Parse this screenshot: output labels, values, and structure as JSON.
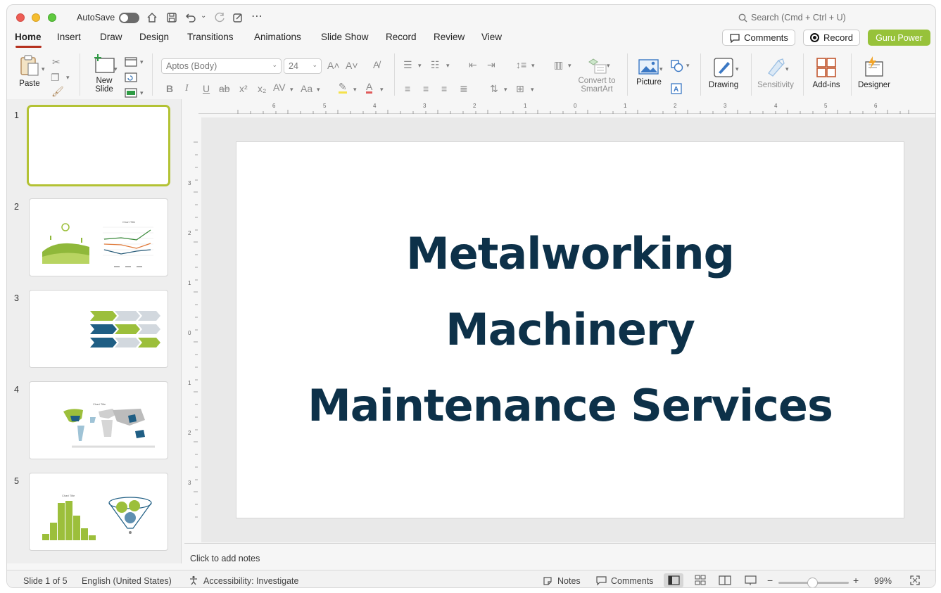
{
  "titlebar": {
    "autosave_label": "AutoSave",
    "search_placeholder": "Search (Cmd + Ctrl + U)"
  },
  "tabs": [
    "Home",
    "Insert",
    "Draw",
    "Design",
    "Transitions",
    "Animations",
    "Slide Show",
    "Record",
    "Review",
    "View"
  ],
  "header_buttons": {
    "comments": "Comments",
    "record": "Record",
    "guru": "Guru Power"
  },
  "ribbon": {
    "paste": "Paste",
    "new_slide_line1": "New",
    "new_slide_line2": "Slide",
    "font_name": "Aptos (Body)",
    "font_size": "24",
    "convert_line1": "Convert to",
    "convert_line2": "SmartArt",
    "picture": "Picture",
    "drawing": "Drawing",
    "sensitivity": "Sensitivity",
    "addins": "Add-ins",
    "designer": "Designer"
  },
  "thumbnails": [
    {
      "number": "1"
    },
    {
      "number": "2",
      "chart_title": "Chart Title"
    },
    {
      "number": "3"
    },
    {
      "number": "4",
      "chart_title": "Chart Title"
    },
    {
      "number": "5",
      "chart_title": "Chart Title"
    }
  ],
  "ruler": {
    "horizontal": [
      "6",
      "5",
      "4",
      "3",
      "2",
      "1",
      "0",
      "1",
      "2",
      "3",
      "4",
      "5",
      "6"
    ],
    "vertical": [
      "3",
      "2",
      "1",
      "0",
      "1",
      "2",
      "3"
    ]
  },
  "slide": {
    "title_lines": [
      "Metalworking",
      "Machinery",
      "Maintenance Services"
    ]
  },
  "notes_placeholder": "Click to add notes",
  "statusbar": {
    "slide_info": "Slide 1 of 5",
    "language": "English (United States)",
    "accessibility": "Accessibility: Investigate",
    "notes": "Notes",
    "comments": "Comments",
    "zoom": "99%"
  },
  "colors": {
    "accent_green": "#97c23a",
    "title_navy": "#0d3149",
    "active_tab_underline": "#b5301e"
  }
}
